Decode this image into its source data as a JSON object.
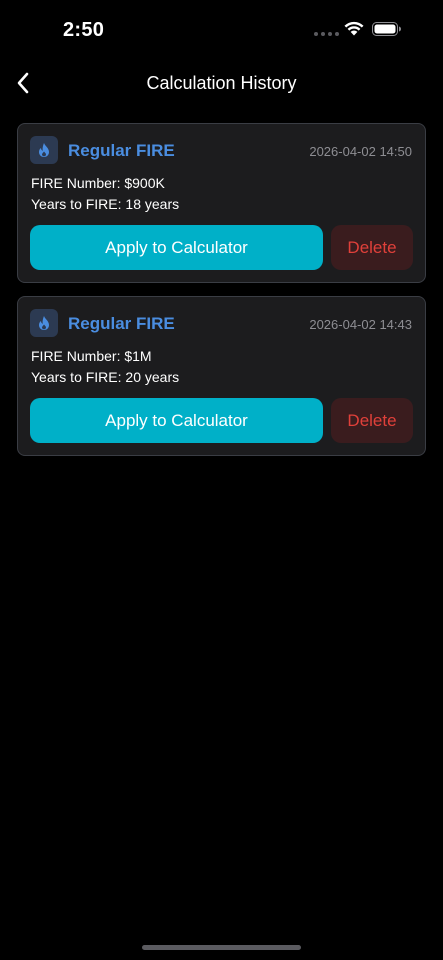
{
  "status_bar": {
    "time": "2:50"
  },
  "nav": {
    "title": "Calculation History"
  },
  "history": [
    {
      "type": "Regular FIRE",
      "timestamp": "2026-04-02 14:50",
      "fire_number": "FIRE Number: $900K",
      "years_to_fire": "Years to FIRE: 18 years",
      "apply_label": "Apply to Calculator",
      "delete_label": "Delete"
    },
    {
      "type": "Regular FIRE",
      "timestamp": "2026-04-02 14:43",
      "fire_number": "FIRE Number: $1M",
      "years_to_fire": "Years to FIRE: 20 years",
      "apply_label": "Apply to Calculator",
      "delete_label": "Delete"
    }
  ],
  "icons": {
    "back": "chevron-left-icon",
    "type": "flame-icon",
    "wifi": "wifi-icon",
    "battery": "battery-icon",
    "signal": "signal-icon"
  },
  "colors": {
    "background": "#000000",
    "card_background": "#1c1c1e",
    "card_border": "#3a3d44",
    "accent_blue": "#4a8de0",
    "apply_button": "#00b0c8",
    "delete_text": "#e0403a",
    "delete_background": "#3a1c1e",
    "timestamp": "#8e8e93"
  }
}
